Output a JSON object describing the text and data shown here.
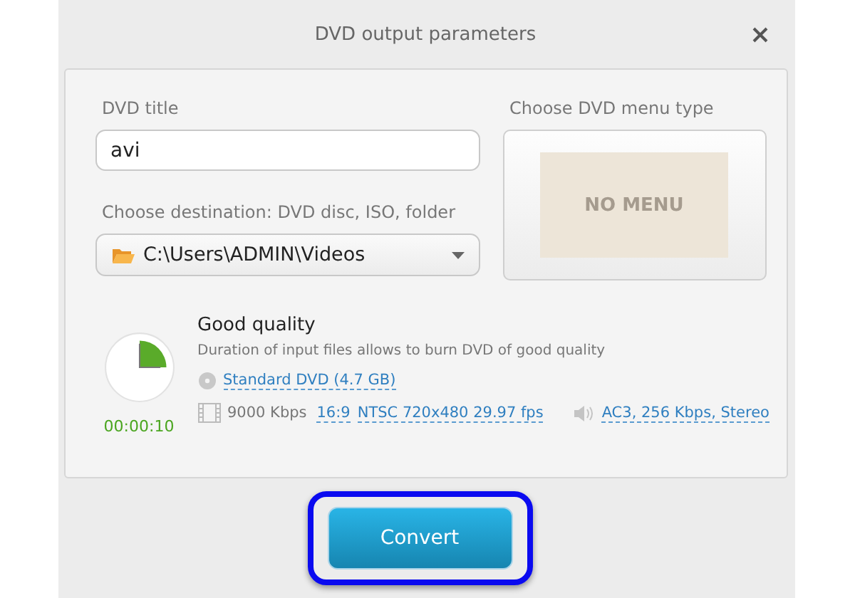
{
  "window": {
    "title": "DVD output parameters"
  },
  "title_field": {
    "label": "DVD title",
    "value": "avi"
  },
  "destination": {
    "label": "Choose destination: DVD disc, ISO, folder",
    "value": "C:\\Users\\ADMIN\\Videos"
  },
  "menu_type": {
    "label": "Choose DVD menu type",
    "option": "NO MENU"
  },
  "quality": {
    "duration": "00:00:10",
    "title": "Good quality",
    "description": "Duration of input files allows to burn DVD of good quality",
    "disc": "Standard DVD (4.7 GB)",
    "bitrate": "9000 Kbps",
    "aspect": "16:9",
    "video": "NTSC 720x480 29.97 fps",
    "audio": "AC3, 256 Kbps, Stereo"
  },
  "buttons": [
    "Convert"
  ]
}
